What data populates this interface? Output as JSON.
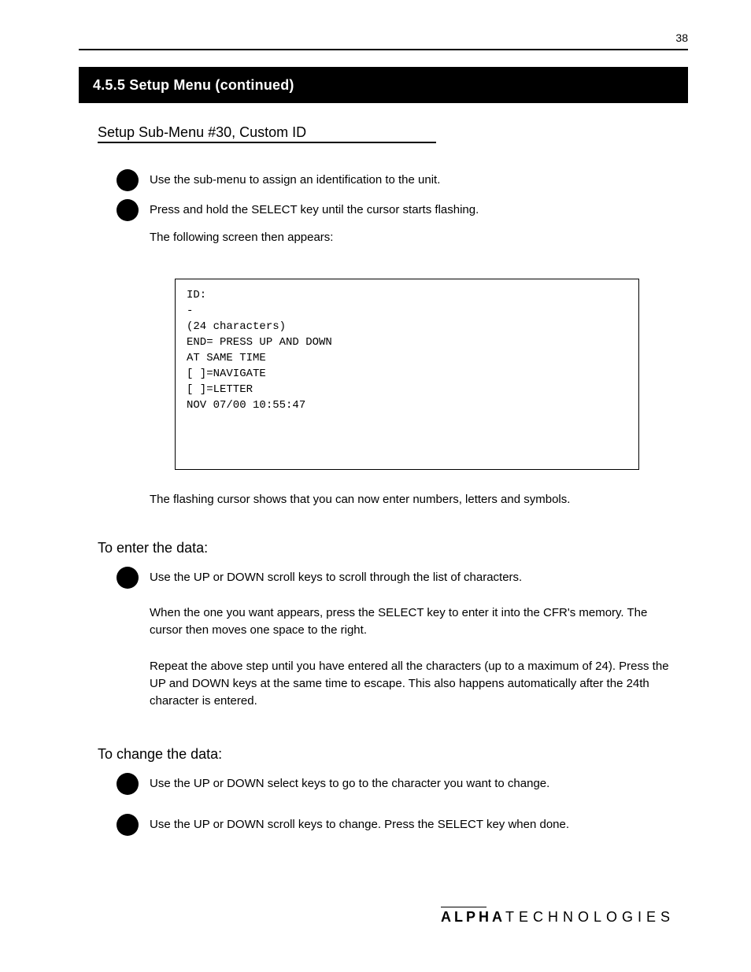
{
  "page_number_top": "38",
  "bar_title": "4.5.5 Setup Menu (continued)",
  "section": {
    "title": "Setup Sub-Menu #30, Custom ID"
  },
  "bullet1": "Use the sub-menu to assign an identification to the unit.",
  "bullet2": "Press and hold the SELECT key until the cursor starts flashing.",
  "subtext1": "The following screen then appears:",
  "codebox": "ID:\n-\n(24 characters)\nEND= PRESS UP AND DOWN\nAT SAME TIME\n[ ]=NAVIGATE\n[ ]=LETTER\nNOV 07/00 10:55:47",
  "post_box": "The flashing cursor shows that you can now enter numbers, letters and symbols.",
  "subA_title": "To enter the data:",
  "subA_bullet": "Use the UP or DOWN scroll keys to scroll through the list of characters.",
  "subA_text1": "When the one you want appears, press the SELECT key to enter it into the CFR's memory. The cursor then moves one space to the right.",
  "subA_text2": "Repeat the above step until you have entered all the characters (up to a maximum of 24). Press the UP and DOWN keys at the same time to escape. This also happens automatically after the 24th character is entered.",
  "subB_title": "To change the data:",
  "subB_bullet1": "Use the UP or DOWN select keys to go to the character you want to change.",
  "subB_bullet2": "Use the UP or DOWN scroll keys to change. Press the SELECT key when done.",
  "footer_bold": "ALPHA",
  "footer_rest": "TECHNOLOGIES"
}
